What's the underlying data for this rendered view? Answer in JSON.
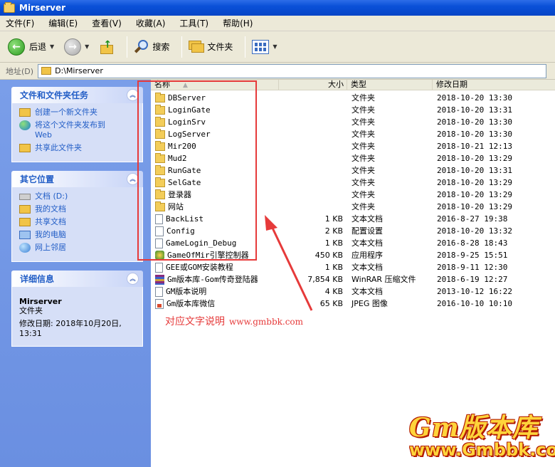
{
  "window": {
    "title": "Mirserver"
  },
  "menu": [
    "文件(F)",
    "编辑(E)",
    "查看(V)",
    "收藏(A)",
    "工具(T)",
    "帮助(H)"
  ],
  "toolbar": {
    "back": "后退",
    "search": "搜索",
    "folders": "文件夹"
  },
  "address": {
    "label": "地址(D)",
    "value": "D:\\Mirserver"
  },
  "tasks_panel": {
    "title": "文件和文件夹任务",
    "items": [
      "创建一个新文件夹",
      "将这个文件夹发布到",
      "Web",
      "共享此文件夹"
    ]
  },
  "places_panel": {
    "title": "其它位置",
    "items": [
      "文档 (D:)",
      "我的文档",
      "共享文档",
      "我的电脑",
      "网上邻居"
    ]
  },
  "details_panel": {
    "title": "详细信息",
    "name": "Mirserver",
    "type": "文件夹",
    "modified_label": "修改日期: 2018年10月20日,",
    "modified_time": "13:31"
  },
  "columns": {
    "name": "名称",
    "size": "大小",
    "type": "类型",
    "modified": "修改日期"
  },
  "files": [
    {
      "name": "DBServer",
      "size": "",
      "type": "文件夹",
      "date": "2018-10-20 13:30",
      "icon": "folder"
    },
    {
      "name": "LoginGate",
      "size": "",
      "type": "文件夹",
      "date": "2018-10-20 13:31",
      "icon": "folder"
    },
    {
      "name": "LoginSrv",
      "size": "",
      "type": "文件夹",
      "date": "2018-10-20 13:30",
      "icon": "folder"
    },
    {
      "name": "LogServer",
      "size": "",
      "type": "文件夹",
      "date": "2018-10-20 13:30",
      "icon": "folder"
    },
    {
      "name": "Mir200",
      "size": "",
      "type": "文件夹",
      "date": "2018-10-21 12:13",
      "icon": "folder"
    },
    {
      "name": "Mud2",
      "size": "",
      "type": "文件夹",
      "date": "2018-10-20 13:29",
      "icon": "folder"
    },
    {
      "name": "RunGate",
      "size": "",
      "type": "文件夹",
      "date": "2018-10-20 13:31",
      "icon": "folder"
    },
    {
      "name": "SelGate",
      "size": "",
      "type": "文件夹",
      "date": "2018-10-20 13:29",
      "icon": "folder"
    },
    {
      "name": "登录器",
      "size": "",
      "type": "文件夹",
      "date": "2018-10-20 13:29",
      "icon": "folder"
    },
    {
      "name": "网站",
      "size": "",
      "type": "文件夹",
      "date": "2018-10-20 13:29",
      "icon": "folder"
    },
    {
      "name": "BackList",
      "size": "1 KB",
      "type": "文本文档",
      "date": "2016-8-27 19:38",
      "icon": "txt"
    },
    {
      "name": "Config",
      "size": "2 KB",
      "type": "配置设置",
      "date": "2018-10-20 13:32",
      "icon": "ini"
    },
    {
      "name": "GameLogin_Debug",
      "size": "1 KB",
      "type": "文本文档",
      "date": "2016-8-28 18:43",
      "icon": "txt"
    },
    {
      "name": "GameOfMir引擎控制器",
      "size": "450 KB",
      "type": "应用程序",
      "date": "2018-9-25 15:51",
      "icon": "exe"
    },
    {
      "name": "GEE或GOM安装教程",
      "size": "1 KB",
      "type": "文本文档",
      "date": "2018-9-11 12:30",
      "icon": "txt"
    },
    {
      "name": "Gm版本库-Gom传奇登陆器",
      "size": "7,854 KB",
      "type": "WinRAR 压缩文件",
      "date": "2018-6-19 12:27",
      "icon": "rar"
    },
    {
      "name": "GM版本说明",
      "size": "4 KB",
      "type": "文本文档",
      "date": "2013-10-12 16:22",
      "icon": "txt"
    },
    {
      "name": "Gm版本库微信",
      "size": "65 KB",
      "type": "JPEG 图像",
      "date": "2016-10-10 10:10",
      "icon": "jpg"
    }
  ],
  "annotation": {
    "text": "对应文字说明",
    "url": "www.gmbbk.com"
  },
  "watermark": {
    "brand": "Gm版本库",
    "url": "www.Gmbbk.com"
  },
  "colors": {
    "annotation_red": "#e63a3a",
    "link_blue": "#215dc6",
    "title_blue": "#0a50d8"
  }
}
